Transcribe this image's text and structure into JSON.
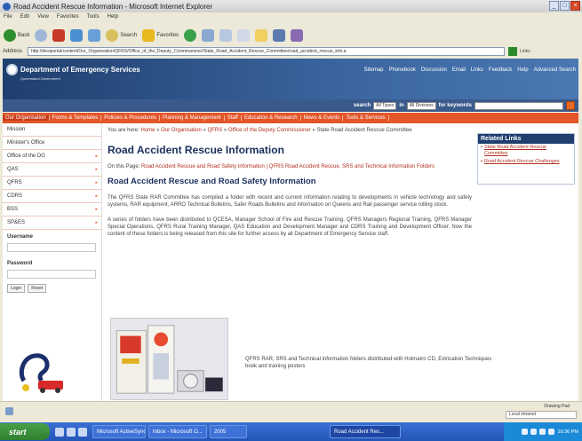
{
  "window": {
    "title": "Road Accident Rescue Information - Microsoft Internet Explorer"
  },
  "menu": [
    "File",
    "Edit",
    "View",
    "Favorites",
    "Tools",
    "Help"
  ],
  "toolbar": {
    "back": "Back",
    "search": "Search",
    "favorites": "Favorites"
  },
  "address": {
    "label": "Address",
    "url": "http://desiportal/content/Our_Organisation/QFRS/Office_of_the_Deputy_Commissioner/State_Road_Accident_Rescue_Committee/road_accident_rescue_info.a",
    "go": "Go",
    "links": "Links"
  },
  "site": {
    "name": "Department of Emergency Services",
    "sub": "Queensland Government",
    "top_links": [
      "Sitemap",
      "Phonebook",
      "Discussion",
      "Email",
      "Links",
      "Feedback",
      "Help",
      "Advanced Search"
    ],
    "search_label": "search",
    "search_type": "All Types",
    "in_label": "in",
    "division": "All Divisions",
    "keywords_label": "for keywords"
  },
  "nav": [
    "Our Organisation",
    "Forms & Templates",
    "Policies & Procedures",
    "Planning & Management",
    "Staff",
    "Education & Research",
    "News & Events",
    "Tools & Services"
  ],
  "sidebar": {
    "items": [
      "Mission",
      "Minister's Office",
      "Office of the DG",
      "QAS",
      "QFRS",
      "CDRS",
      "BSS",
      "SP&ES"
    ],
    "username_label": "Username",
    "password_label": "Password",
    "login": "Login",
    "reset": "Reset"
  },
  "main": {
    "breadcrumb_prefix": "You are here: ",
    "breadcrumb": [
      "Home",
      "Our Organisation",
      "QFRS",
      "Office of the Deputy Commissioner"
    ],
    "breadcrumb_current": "State Road Accident Rescue Committee",
    "title": "Road Accident Rescue Information",
    "on_this_page_label": "On this Page: ",
    "on_this_page_links": "Road Accident Rescue and Road Safety Information | QFRS Road Accident Rescue, SRS and Technical Information Folders",
    "subtitle": "Road Accident Rescue and Road Safety Information",
    "para1": "The QFRS State RAR Committee has compiled a folder with recent and current information relating to developments in vehicle technology and safety systems, RAR equipment, ARRO Technical Bulletins, Safer Roads Bulletins and information on Queens and Rail passenger service rolling stock.",
    "para2": "A series of folders have been distributed to QCESA, Manager School of Fire and Rescue Training, QFRS Managers Regional Training, QFRS Manager Special Operations, QFRS Rural Training Manager, QAS Education and Development Manager and CDRS Training and Development Officer. Now the content of these folders is being released from this site for further access by all Department of Emergency Service staff.",
    "caption": "QFRS RAR, SRS and Technical information folders distributed with Holmatro CD, Extrication Techniques book and training posters"
  },
  "related": {
    "title": "Related Links",
    "links": [
      "State Road Accident Rescue Committee",
      "Road Accident Rescue Challenges"
    ]
  },
  "status": {
    "tip": "Drawing Pad",
    "zone": "Local intranet"
  },
  "taskbar": {
    "start": "start",
    "buttons": [
      "Microsoft ActiveSync",
      "Inbox - Microsoft O...",
      "2005",
      "Road Accident Res..."
    ],
    "clock": "10:36 PM"
  }
}
